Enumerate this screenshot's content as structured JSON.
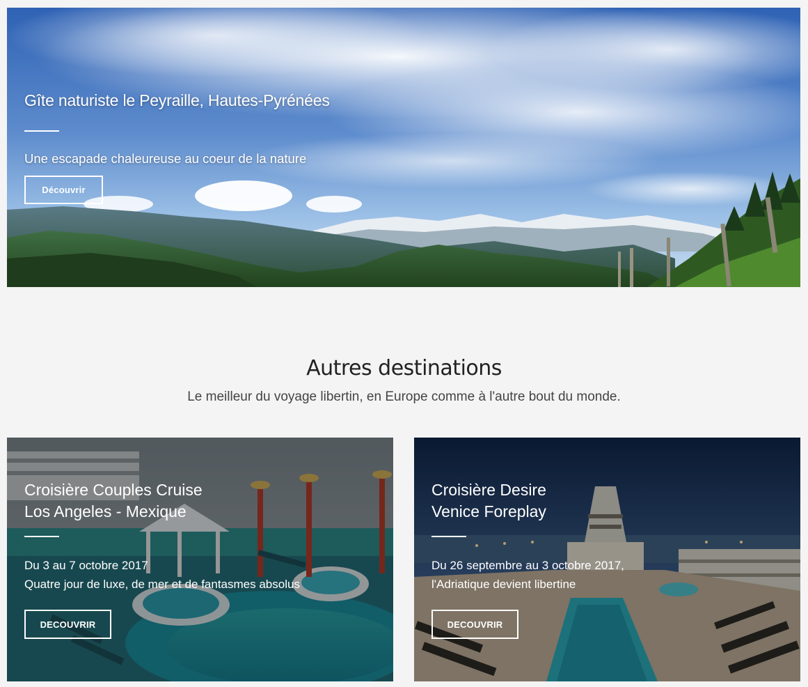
{
  "hero": {
    "title": "Gîte naturiste le Peyraille, Hautes-Pyrénées",
    "subtitle": "Une escapade chaleureuse au coeur de la nature",
    "button_label": "Découvrir"
  },
  "section": {
    "title": "Autres destinations",
    "subtitle": "Le meilleur du voyage libertin, en Europe comme à l'autre bout du monde."
  },
  "cards": [
    {
      "title_line1": "Croisière Couples Cruise",
      "title_line2": "Los Angeles - Mexique",
      "date": "Du 3 au 7 octobre 2017",
      "description": "Quatre jour de luxe, de mer et de fantasmes absolus",
      "button_label": "DECOUVRIR"
    },
    {
      "title_line1": "Croisière Desire",
      "title_line2": "Venice Foreplay",
      "date": "Du 26 septembre au 3 octobre 2017,",
      "description": "l'Adriatique devient libertine",
      "button_label": "DECOUVRIR"
    }
  ],
  "colors": {
    "page_background": "#f4f4f4",
    "overlay_text": "#ffffff",
    "heading_text": "#222222"
  }
}
